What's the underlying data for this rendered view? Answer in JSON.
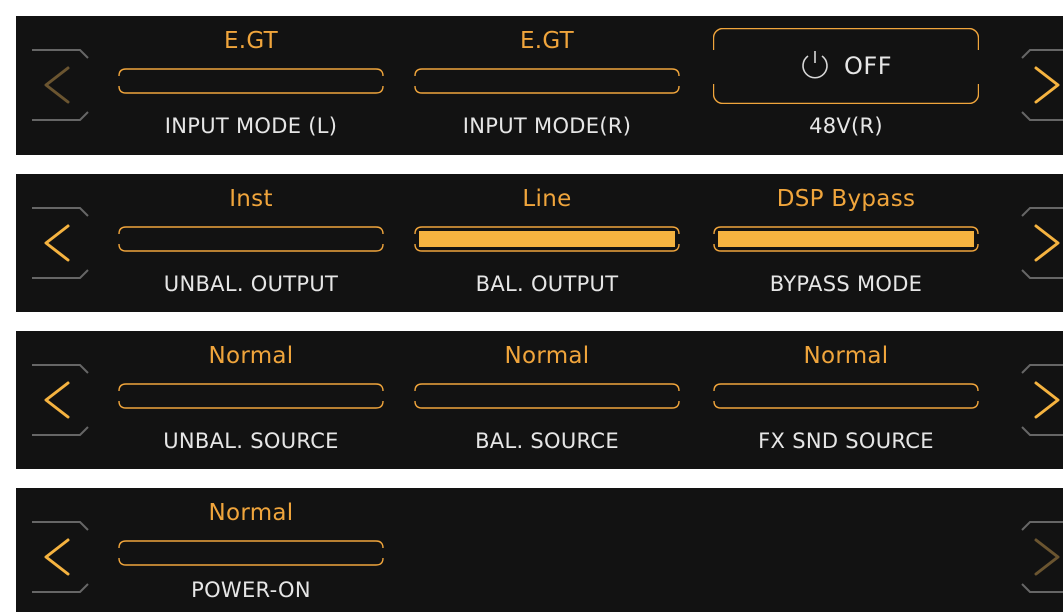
{
  "rows": [
    {
      "slots": [
        {
          "value": "E.GT",
          "fill": 0,
          "label": "INPUT MODE (L)"
        },
        {
          "value": "E.GT",
          "fill": 0,
          "label": "INPUT MODE(R)"
        },
        {
          "power": "OFF",
          "icon": "power-icon",
          "label": "48V(R)"
        }
      ],
      "prev_enabled": false,
      "next_enabled": true
    },
    {
      "slots": [
        {
          "value": "Inst",
          "fill": 0,
          "label": "UNBAL. OUTPUT"
        },
        {
          "value": "Line",
          "fill": 1,
          "label": "BAL. OUTPUT"
        },
        {
          "value": "DSP Bypass",
          "fill": 1,
          "label": "BYPASS MODE"
        }
      ],
      "prev_enabled": true,
      "next_enabled": true
    },
    {
      "slots": [
        {
          "value": "Normal",
          "fill": 0,
          "label": "UNBAL. SOURCE"
        },
        {
          "value": "Normal",
          "fill": 0,
          "label": "BAL. SOURCE"
        },
        {
          "value": "Normal",
          "fill": 0,
          "label": "FX SND SOURCE"
        }
      ],
      "prev_enabled": true,
      "next_enabled": true
    },
    {
      "slots": [
        {
          "value": "Normal",
          "fill": 0,
          "label": "POWER-ON"
        }
      ],
      "prev_enabled": true,
      "next_enabled": false
    }
  ],
  "colors": {
    "accent": "#f0a53c",
    "enabled_arrow": "#f5b340",
    "disabled_arrow": "#6b5530",
    "panel_bg": "#121212",
    "bracket": "#666666",
    "label": "#e6e6e6"
  }
}
